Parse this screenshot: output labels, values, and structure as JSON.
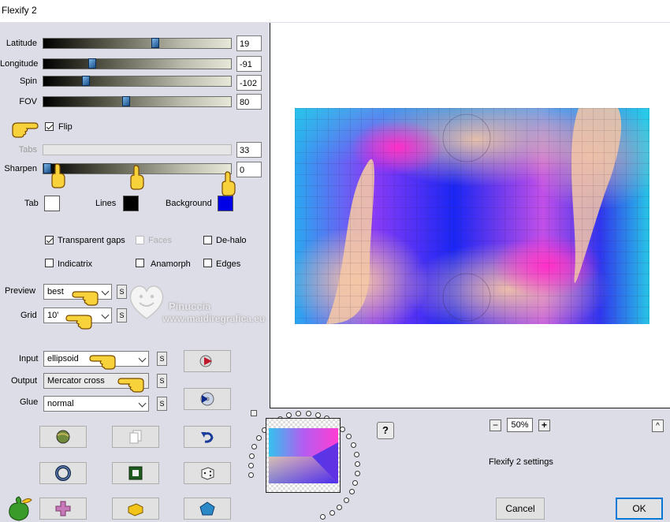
{
  "window": {
    "title": "Flexify 2"
  },
  "params": {
    "latitude": {
      "label": "Latitude",
      "value": "19",
      "pos": 0.58
    },
    "longitude": {
      "label": "Longitude",
      "value": "-91",
      "pos": 0.25
    },
    "spin": {
      "label": "Spin",
      "value": "-102",
      "pos": 0.22
    },
    "fov": {
      "label": "FOV",
      "value": "80",
      "pos": 0.42
    },
    "tabs": {
      "label": "Tabs",
      "value": "33"
    },
    "sharpen": {
      "label": "Sharpen",
      "value": "0",
      "pos": 0.0
    }
  },
  "flip": {
    "label": "Flip",
    "checked": true
  },
  "colors": {
    "tab": {
      "label": "Tab",
      "hex": "#ffffff"
    },
    "lines": {
      "label": "Lines",
      "hex": "#000000"
    },
    "background": {
      "label": "Background",
      "hex": "#0000e6"
    }
  },
  "options": {
    "transparent_gaps": "Transparent gaps",
    "faces": "Faces",
    "dehalo": "De-halo",
    "indicatrix": "Indicatrix",
    "anamorph": "Anamorph",
    "edges": "Edges"
  },
  "selects": {
    "preview": {
      "label": "Preview",
      "value": "best"
    },
    "grid": {
      "label": "Grid",
      "value": "10'"
    },
    "input": {
      "label": "Input",
      "value": "ellipsoid"
    },
    "output": {
      "label": "Output",
      "value": "Mercator cross"
    },
    "glue": {
      "label": "Glue",
      "value": "normal"
    }
  },
  "s_label": "S",
  "watermark": {
    "name": "Pinuccia",
    "site": "www.maidiregrafica.eu"
  },
  "zoom": {
    "value": "50%",
    "minus": "−",
    "plus": "+"
  },
  "help": "?",
  "collapse": "^",
  "settings_label": "Flexify 2 settings",
  "buttons": {
    "cancel": "Cancel",
    "ok": "OK"
  }
}
